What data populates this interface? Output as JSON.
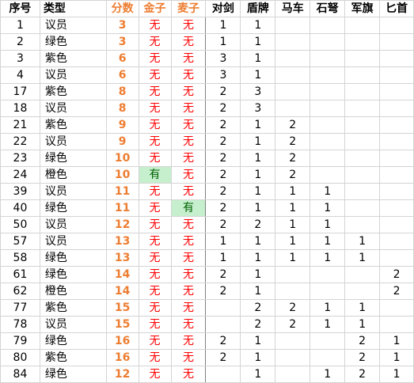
{
  "headers": [
    "序号",
    "类型",
    "分数",
    "金子",
    "麦子",
    "对剑",
    "盾牌",
    "马车",
    "石弩",
    "军旗",
    "匕首"
  ],
  "rows": [
    [
      "1",
      "议员",
      "3",
      "无",
      "无",
      "1",
      "1",
      "",
      "",
      "",
      ""
    ],
    [
      "2",
      "绿色",
      "3",
      "无",
      "无",
      "1",
      "1",
      "",
      "",
      "",
      ""
    ],
    [
      "3",
      "紫色",
      "6",
      "无",
      "无",
      "3",
      "1",
      "",
      "",
      "",
      ""
    ],
    [
      "4",
      "议员",
      "6",
      "无",
      "无",
      "3",
      "1",
      "",
      "",
      "",
      ""
    ],
    [
      "17",
      "紫色",
      "8",
      "无",
      "无",
      "2",
      "3",
      "",
      "",
      "",
      ""
    ],
    [
      "18",
      "议员",
      "8",
      "无",
      "无",
      "2",
      "3",
      "",
      "",
      "",
      ""
    ],
    [
      "21",
      "紫色",
      "9",
      "无",
      "无",
      "2",
      "1",
      "2",
      "",
      "",
      ""
    ],
    [
      "22",
      "议员",
      "9",
      "无",
      "无",
      "2",
      "1",
      "2",
      "",
      "",
      ""
    ],
    [
      "23",
      "绿色",
      "10",
      "无",
      "无",
      "2",
      "1",
      "2",
      "",
      "",
      ""
    ],
    [
      "24",
      "橙色",
      "10",
      "有",
      "无",
      "2",
      "1",
      "2",
      "",
      "",
      ""
    ],
    [
      "39",
      "议员",
      "11",
      "无",
      "无",
      "2",
      "1",
      "1",
      "1",
      "",
      ""
    ],
    [
      "40",
      "绿色",
      "11",
      "无",
      "有",
      "2",
      "1",
      "1",
      "1",
      "",
      ""
    ],
    [
      "50",
      "议员",
      "12",
      "无",
      "无",
      "2",
      "2",
      "1",
      "1",
      "",
      ""
    ],
    [
      "57",
      "议员",
      "13",
      "无",
      "无",
      "1",
      "1",
      "1",
      "1",
      "1",
      ""
    ],
    [
      "58",
      "绿色",
      "13",
      "无",
      "无",
      "1",
      "1",
      "1",
      "1",
      "1",
      ""
    ],
    [
      "61",
      "绿色",
      "14",
      "无",
      "无",
      "2",
      "1",
      "",
      "",
      "",
      "2"
    ],
    [
      "62",
      "橙色",
      "14",
      "无",
      "无",
      "2",
      "1",
      "",
      "",
      "",
      "2"
    ],
    [
      "77",
      "紫色",
      "15",
      "无",
      "无",
      "",
      "2",
      "2",
      "1",
      "1",
      ""
    ],
    [
      "78",
      "议员",
      "15",
      "无",
      "无",
      "",
      "2",
      "2",
      "1",
      "1",
      ""
    ],
    [
      "79",
      "绿色",
      "16",
      "无",
      "无",
      "2",
      "1",
      "",
      "",
      "2",
      "1"
    ],
    [
      "80",
      "紫色",
      "16",
      "无",
      "无",
      "2",
      "1",
      "",
      "",
      "2",
      "1"
    ],
    [
      "84",
      "绿色",
      "12",
      "无",
      "无",
      "",
      "1",
      "",
      "1",
      "2",
      "1"
    ]
  ],
  "colors": {
    "score": "#ed7d31",
    "flag_none": "#ff0000",
    "flag_has_bg": "#c6efce",
    "flag_has_text": "#006100"
  }
}
